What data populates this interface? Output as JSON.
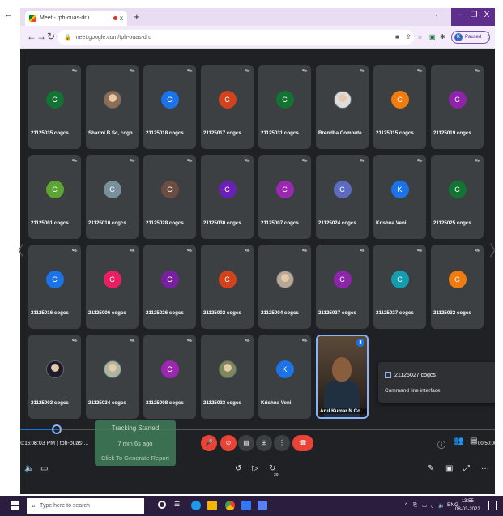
{
  "browser": {
    "tab_title": "Meet - tph-ouas-dru",
    "tab_close": "x",
    "new_tab": "+",
    "url": "meet.google.com/tph-ouas-dru",
    "profile_status": "Paused",
    "window_minimize": "–",
    "window_restore": "❐",
    "window_close": "X"
  },
  "tiles": [
    {
      "name": "21125035 cogcs",
      "initial": "C",
      "color": "#137333",
      "photo": false
    },
    {
      "name": "Sharmi B.Sc, cogn...",
      "initial": "",
      "color": "#8d6e53",
      "photo": true
    },
    {
      "name": "21125018 cogcs",
      "initial": "C",
      "color": "#1a73e8",
      "photo": false
    },
    {
      "name": "21125017 cogcs",
      "initial": "C",
      "color": "#d2421b",
      "photo": false
    },
    {
      "name": "21125031 cogcs",
      "initial": "C",
      "color": "#137333",
      "photo": false
    },
    {
      "name": "Brendha Compute...",
      "initial": "",
      "color": "#ddd",
      "photo": true
    },
    {
      "name": "21125015 cogcs",
      "initial": "C",
      "color": "#f07b0f",
      "photo": false
    },
    {
      "name": "21125019 cogcs",
      "initial": "C",
      "color": "#8e24aa",
      "photo": false
    },
    {
      "name": "21125001 cogcs",
      "initial": "C",
      "color": "#5da533",
      "photo": false
    },
    {
      "name": "21125010 cogcs",
      "initial": "C",
      "color": "#78909c",
      "photo": false
    },
    {
      "name": "21125028 cogcs",
      "initial": "C",
      "color": "#6d4c41",
      "photo": false
    },
    {
      "name": "21125030 cogcs",
      "initial": "C",
      "color": "#6a1fb8",
      "photo": false
    },
    {
      "name": "21125007 cogcs",
      "initial": "C",
      "color": "#9c27b0",
      "photo": false
    },
    {
      "name": "21125024 cogcs",
      "initial": "C",
      "color": "#5c6bc0",
      "photo": false
    },
    {
      "name": "Krishna Veni",
      "initial": "K",
      "color": "#1a73e8",
      "photo": false
    },
    {
      "name": "21125025 cogcs",
      "initial": "C",
      "color": "#137333",
      "photo": false
    },
    {
      "name": "21125016 cogcs",
      "initial": "C",
      "color": "#1a73e8",
      "photo": false
    },
    {
      "name": "21125006 cogcs",
      "initial": "C",
      "color": "#e91e63",
      "photo": false
    },
    {
      "name": "21125026 cogcs",
      "initial": "C",
      "color": "#7b1fa2",
      "photo": false
    },
    {
      "name": "21125002 cogcs",
      "initial": "C",
      "color": "#d2421b",
      "photo": false
    },
    {
      "name": "21125004 cogcs",
      "initial": "",
      "color": "#b7a89a",
      "photo": true
    },
    {
      "name": "21125037 cogcs",
      "initial": "C",
      "color": "#8e24aa",
      "photo": false
    },
    {
      "name": "21125027 cogcs",
      "initial": "C",
      "color": "#129eaf",
      "photo": false
    },
    {
      "name": "21125032 cogcs",
      "initial": "C",
      "color": "#f07b0f",
      "photo": false
    },
    {
      "name": "21125003 cogcs",
      "initial": "",
      "color": "#1c1c2e",
      "photo": true
    },
    {
      "name": "21125034 cogcs",
      "initial": "",
      "color": "#a9b7a0",
      "photo": true
    },
    {
      "name": "21125008 cogcs",
      "initial": "C",
      "color": "#9c27b0",
      "photo": false
    },
    {
      "name": "21125023 cogcs",
      "initial": "",
      "color": "#7a8a5a",
      "photo": true
    },
    {
      "name": "Krishna Veni",
      "initial": "K",
      "color": "#1a73e8",
      "photo": false
    },
    {
      "name": "Arul Kumar N Co...",
      "initial": "",
      "color": "",
      "photo": false,
      "speaking": true
    }
  ],
  "popup": {
    "title": "21125027 cogcs",
    "subtitle": "Command line interface"
  },
  "player": {
    "elapsed": "00:16:08",
    "total": "00:50:06",
    "meeting_time": "8:03 PM",
    "meeting_code": "tph-ouas-...",
    "tracking_title": "Tracking Started",
    "tracking_elapsed": "7 min 6s ago",
    "tracking_action": "Click To Generate Report",
    "speed_label": "30"
  },
  "taskbar": {
    "search_placeholder": "Type here to search",
    "language": "ENG",
    "time": "13:55",
    "date": "08-03-2022"
  }
}
